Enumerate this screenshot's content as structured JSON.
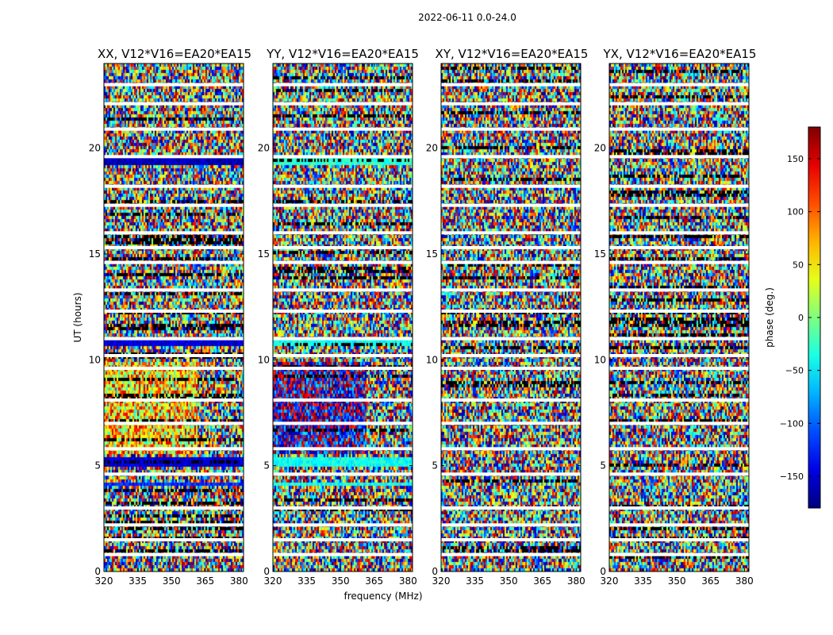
{
  "chart_data": {
    "type": "heatmap",
    "title": "2022-06-11 0.0-24.0",
    "xlabel": "frequency (MHz)",
    "ylabel": "UT (hours)",
    "xlim": [
      320,
      382
    ],
    "ylim": [
      0,
      24
    ],
    "xticks": [
      320,
      335,
      350,
      365,
      380
    ],
    "yticks": [
      0,
      5,
      10,
      15,
      20
    ],
    "colorbar": {
      "label": "phase (deg.)",
      "range": [
        -180,
        180
      ],
      "ticks": [
        150,
        100,
        50,
        0,
        -50,
        -100,
        -150
      ],
      "tick_labels": [
        "150",
        "100",
        "50",
        "0",
        "−50",
        "−100",
        "−150"
      ],
      "colormap": "jet"
    },
    "panels": [
      {
        "title": "XX, V12*V16=EA20*EA15",
        "pattern": "xx"
      },
      {
        "title": "YY, V12*V16=EA20*EA15",
        "pattern": "yy"
      },
      {
        "title": "XY, V12*V16=EA20*EA15",
        "pattern": "xy"
      },
      {
        "title": "YX, V12*V16=EA20*EA15",
        "pattern": "yx"
      }
    ],
    "gaps_hours": [
      23.0,
      22.1,
      20.9,
      19.6,
      18.2,
      17.3,
      16.0,
      15.3,
      14.6,
      13.3,
      12.3,
      11.0,
      10.2,
      9.6,
      8.1,
      7.0,
      5.8,
      4.6,
      3.0,
      2.2,
      1.5,
      0.8
    ],
    "coherent_bands": [
      {
        "t0": 19.3,
        "t1": 19.7,
        "xx_phase": -160,
        "yy_phase": -30
      },
      {
        "t0": 10.8,
        "t1": 11.1,
        "xx_phase": -150,
        "yy_phase": -40
      },
      {
        "t0": 5.0,
        "t1": 5.4,
        "xx_phase": -150,
        "yy_phase": -40
      },
      {
        "t0": 4.1,
        "t1": 4.3,
        "xx_phase": -120,
        "yy_phase": -40
      }
    ],
    "regions": [
      {
        "t0": 5.6,
        "t1": 10.0,
        "f1": 361,
        "xx_phase": 60,
        "yy_phase": -150
      }
    ]
  }
}
